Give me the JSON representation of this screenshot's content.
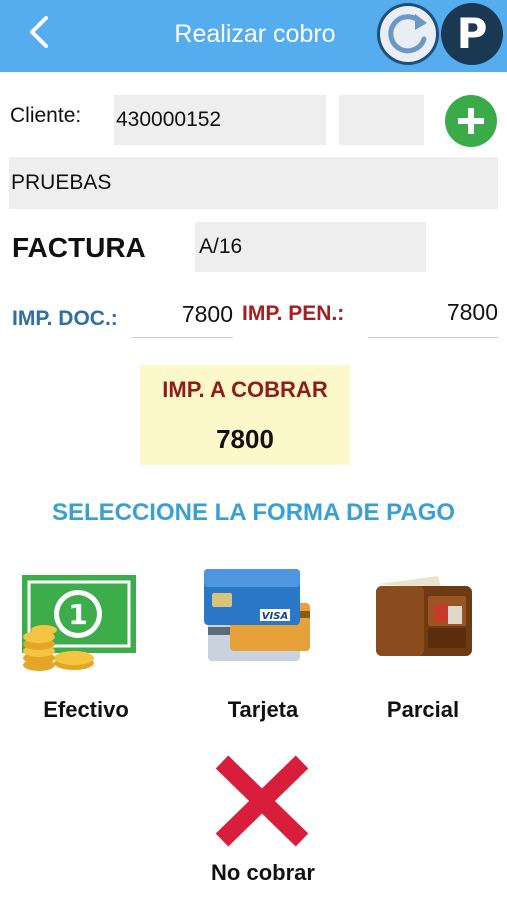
{
  "header": {
    "title": "Realizar cobro",
    "color": "#55acee",
    "p_button_label": "P"
  },
  "cliente": {
    "label": "Cliente:",
    "code": "430000152",
    "extra": "",
    "name": "PRUEBAS"
  },
  "factura": {
    "label": "FACTURA",
    "value": "A/16"
  },
  "importes": {
    "doc_label": "IMP. DOC.:",
    "doc_value": "7800",
    "pen_label": "IMP. PEN.:",
    "pen_value": "7800"
  },
  "cobrar": {
    "label": "IMP. A COBRAR",
    "value": "7800"
  },
  "payment": {
    "title": "SELECCIONE LA FORMA DE PAGO",
    "options": [
      {
        "label": "Efectivo",
        "icon": "cash-icon"
      },
      {
        "label": "Tarjeta",
        "icon": "credit-card-icon"
      },
      {
        "label": "Parcial",
        "icon": "wallet-icon"
      }
    ],
    "cancel": {
      "label": "No cobrar",
      "icon": "cross-icon"
    }
  }
}
